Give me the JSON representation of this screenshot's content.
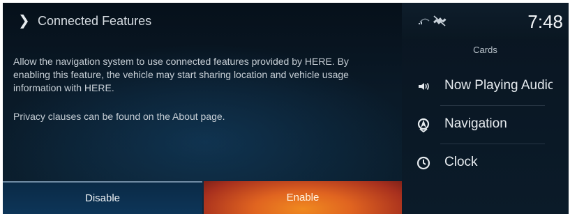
{
  "dialog": {
    "title": "Connected Features",
    "message": "Allow the navigation system to use connected features provided by HERE. By enabling this feature, the vehicle may start sharing location and vehicle usage information with HERE.",
    "privacy_note": "Privacy clauses can be found on the About page.",
    "disable_label": "Disable",
    "enable_label": "Enable"
  },
  "status_bar": {
    "time": "7:48",
    "icons": [
      "signal-icon",
      "gps-off-icon"
    ]
  },
  "cards": {
    "heading": "Cards",
    "items": [
      {
        "label": "Now Playing Audio",
        "icon": "speaker-icon"
      },
      {
        "label": "Navigation",
        "icon": "navigation-icon"
      },
      {
        "label": "Clock",
        "icon": "clock-icon"
      }
    ]
  }
}
